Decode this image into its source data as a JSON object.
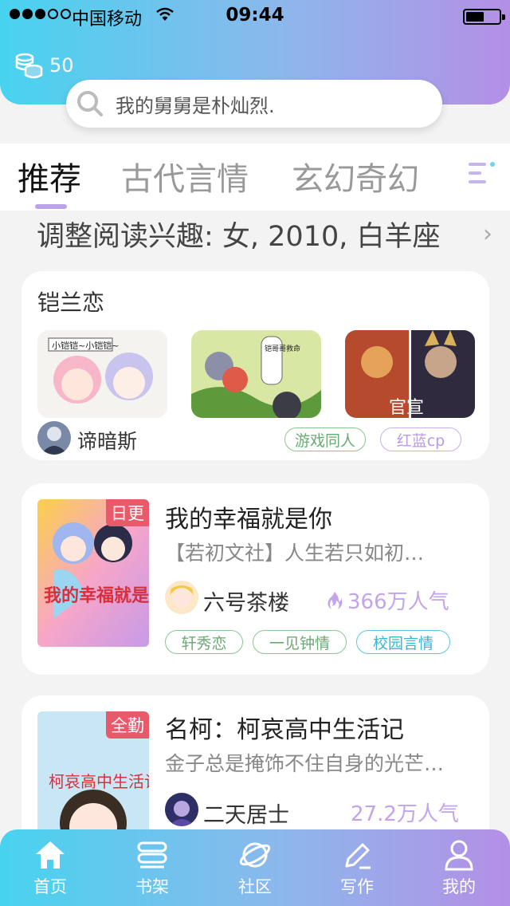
{
  "status_bar": {
    "carrier": "中国移动",
    "time": "09:44"
  },
  "coins": {
    "count": "50"
  },
  "search": {
    "placeholder": "我的舅舅是朴灿烈."
  },
  "tabs": [
    {
      "label": "推荐",
      "active": true
    },
    {
      "label": "古代言情",
      "active": false
    },
    {
      "label": "玄幻奇幻",
      "active": false
    }
  ],
  "interest": {
    "text": "调整阅读兴趣: 女, 2010, 白羊座"
  },
  "topic_card": {
    "title": "铠兰恋",
    "user": "谛暗斯",
    "thumbnails": [
      {
        "caption": "小铠铠~小铠铠~"
      },
      {
        "caption": "铠哥哥救命"
      },
      {
        "caption": "官宣"
      }
    ],
    "tags": [
      "游戏同人",
      "红蓝cp"
    ]
  },
  "books": [
    {
      "badge": "日更",
      "cover_text": "我的幸福就是你",
      "title": "我的幸福就是你",
      "desc": "【若初文社】人生若只如初…",
      "author": "六号茶楼",
      "popularity": "366万人气",
      "tags": [
        "轩秀恋",
        "一见钟情",
        "校园言情"
      ]
    },
    {
      "badge": "全勤",
      "cover_text": "柯哀高中生活记",
      "title": "名柯：柯哀高中生活记",
      "desc": "金子总是掩饰不住自身的光芒…",
      "author": "二天居士",
      "popularity": "27.2万人气",
      "tags": []
    }
  ],
  "nav": [
    {
      "label": "首页",
      "icon": "home-icon"
    },
    {
      "label": "书架",
      "icon": "bookshelf-icon"
    },
    {
      "label": "社区",
      "icon": "planet-icon"
    },
    {
      "label": "写作",
      "icon": "pen-icon"
    },
    {
      "label": "我的",
      "icon": "user-icon"
    }
  ],
  "colors": {
    "gradient_start": "#47d3ef",
    "gradient_end": "#b48fe6",
    "accent": "#bba4e8"
  }
}
